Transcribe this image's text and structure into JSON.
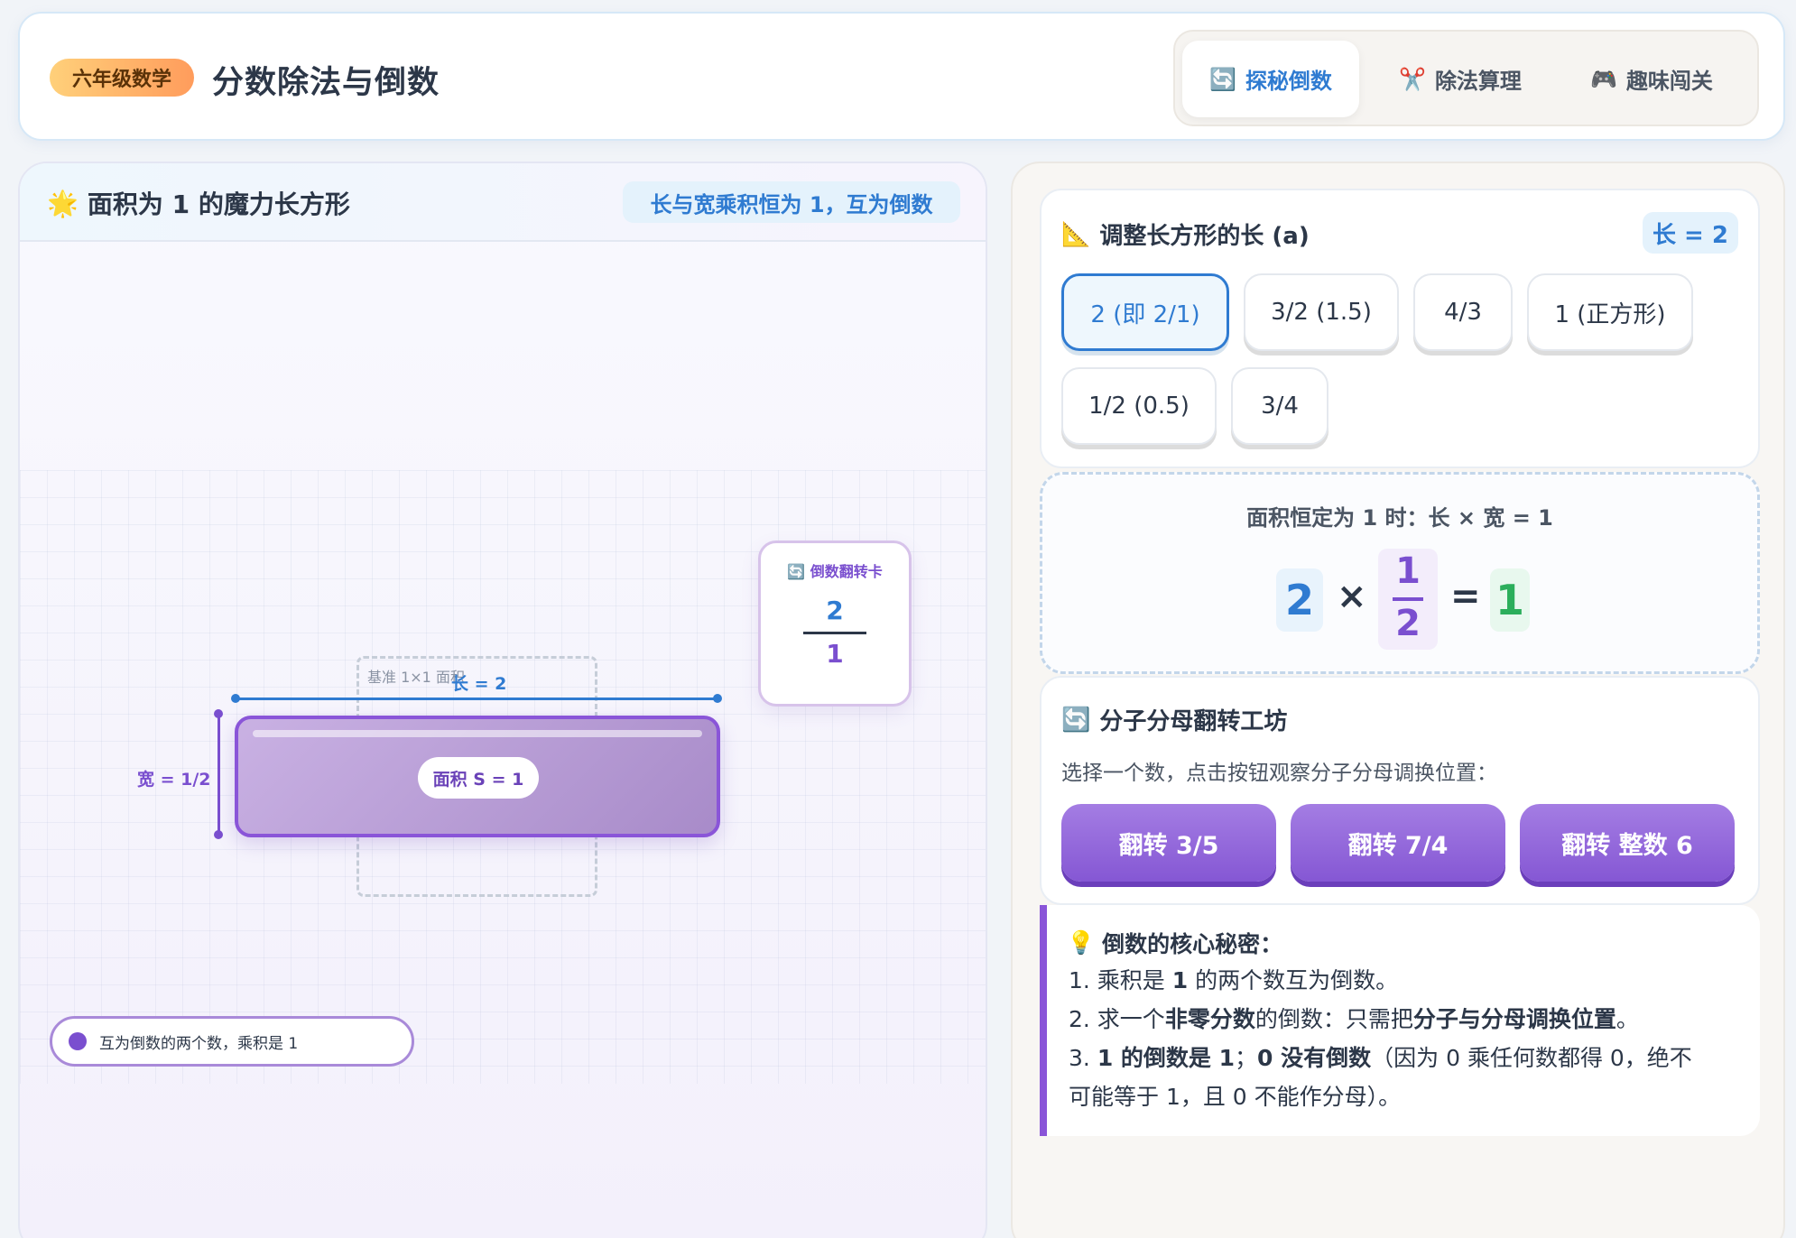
{
  "header": {
    "grade_badge": "六年级数学",
    "title": "分数除法与倒数",
    "tabs": [
      {
        "icon": "🔄",
        "label": "探秘倒数",
        "active": true
      },
      {
        "icon": "✂️",
        "label": "除法算理",
        "active": false
      },
      {
        "icon": "🎮",
        "label": "趣味闯关",
        "active": false
      }
    ]
  },
  "left": {
    "icon": "🌟",
    "title": "面积为 1 的魔力长方形",
    "hint": "长与宽乘积恒为 1，互为倒数",
    "ref_label": "基准 1×1 面积",
    "length_label": "长 = 2",
    "width_label": "宽 = 1/2",
    "area_label": "面积 S = 1",
    "flip_card": {
      "icon": "🔄",
      "title": "倒数翻转卡",
      "numerator": "2",
      "denominator": "1"
    },
    "legend": "互为倒数的两个数，乘积是 1"
  },
  "adjust": {
    "icon": "📐",
    "title": "调整长方形的长 (a)",
    "badge": "长 = 2",
    "options": [
      "2 (即 2/1)",
      "3/2 (1.5)",
      "4/3",
      "1 (正方形)",
      "1/2 (0.5)",
      "3/4"
    ],
    "selected_index": 0
  },
  "formula": {
    "caption": "面积恒定为 1 时：长 × 宽 = 1",
    "a": "2",
    "times": "×",
    "b_num": "1",
    "b_den": "2",
    "equals": "=",
    "result": "1"
  },
  "workshop": {
    "icon": "🔄",
    "title": "分子分母翻转工坊",
    "desc": "选择一个数，点击按钮观察分子分母调换位置：",
    "buttons": [
      "翻转 3/5",
      "翻转 7/4",
      "翻转 整数 6"
    ]
  },
  "secret": {
    "icon": "💡",
    "title": "倒数的核心秘密：",
    "line1_a": "1. 乘积是 ",
    "line1_b": "1",
    "line1_c": " 的两个数互为倒数。",
    "line2_a": "2. 求一个",
    "line2_b": "非零分数",
    "line2_c": "的倒数：只需把",
    "line2_d": "分子与分母调换位置",
    "line2_e": "。",
    "line3_a": "3. ",
    "line3_b": "1 的倒数是 1",
    "line3_c": "；",
    "line3_d": "0 没有倒数",
    "line3_e": "（因为 0 乘任何数都得 0，绝不",
    "line4": "可能等于 1，且 0 不能作分母）。"
  },
  "colors": {
    "blue": "#2f7bd1",
    "purple": "#7a4fcf",
    "green": "#2bae5b"
  }
}
